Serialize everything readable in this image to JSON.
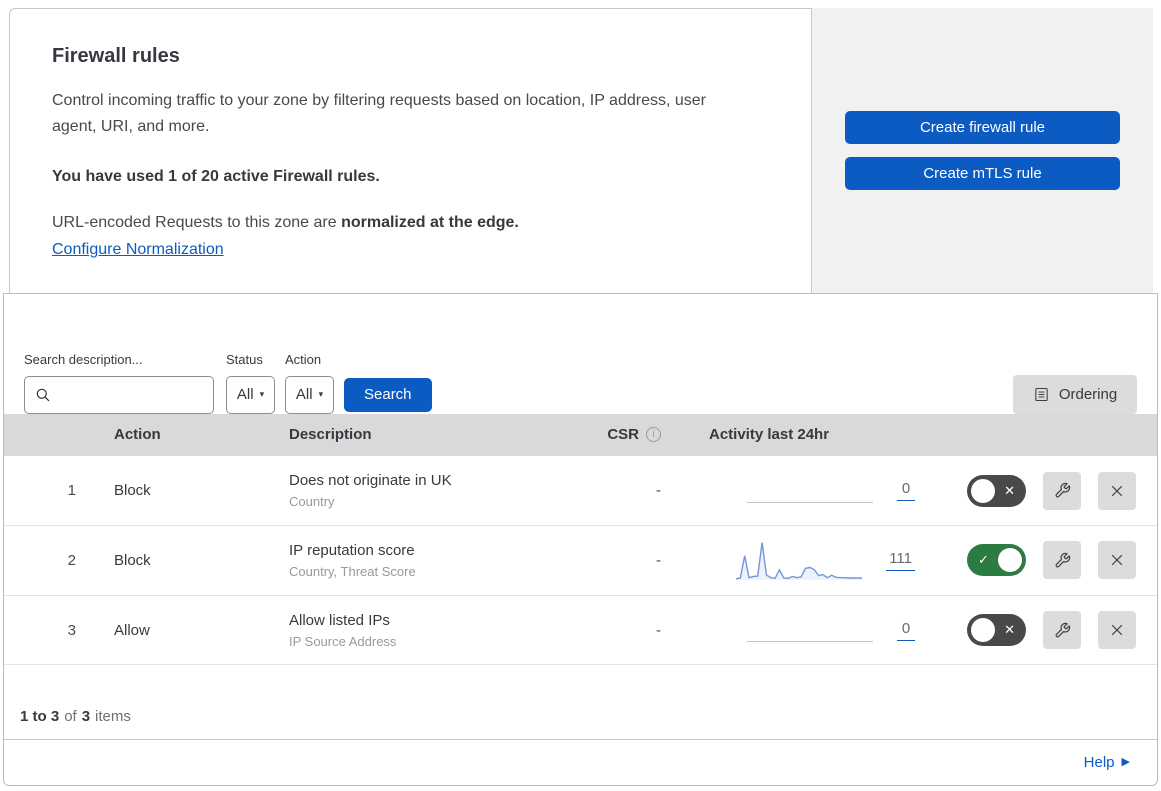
{
  "header": {
    "title": "Firewall rules",
    "description": "Control incoming traffic to your zone by filtering requests based on location, IP address, user agent, URI, and more.",
    "usage": "You have used 1 of 20 active Firewall rules.",
    "normalization_prefix": "URL-encoded Requests to this zone are ",
    "normalization_bold": "normalized at the edge.",
    "normalization_link": "Configure Normalization",
    "create_firewall_label": "Create firewall rule",
    "create_mtls_label": "Create mTLS rule"
  },
  "filters": {
    "search_label": "Search description...",
    "search_value": "",
    "status_label": "Status",
    "status_value": "All",
    "action_label": "Action",
    "action_value": "All",
    "search_button_label": "Search",
    "ordering_button_label": "Ordering"
  },
  "table": {
    "columns": {
      "action": "Action",
      "description": "Description",
      "csr": "CSR",
      "activity": "Activity last 24hr"
    },
    "rows": [
      {
        "index": "1",
        "action": "Block",
        "title": "Does not originate in UK",
        "subtitle": "Country",
        "csr": "-",
        "count": "0",
        "enabled": false,
        "sparkline": null
      },
      {
        "index": "2",
        "action": "Block",
        "title": "IP reputation score",
        "subtitle": "Country, Threat Score",
        "csr": "-",
        "count": "111",
        "enabled": true,
        "sparkline": [
          0.3,
          0.5,
          6.2,
          0.6,
          0.9,
          1.0,
          9.6,
          1.3,
          0.6,
          0.4,
          2.6,
          0.5,
          0.4,
          0.9,
          0.6,
          0.8,
          3.0,
          3.2,
          2.7,
          1.1,
          1.4,
          0.6,
          1.2,
          0.7,
          0.6,
          0.6,
          0.5,
          0.5,
          0.5,
          0.5
        ]
      },
      {
        "index": "3",
        "action": "Allow",
        "title": "Allow listed IPs",
        "subtitle": "IP Source Address",
        "csr": "-",
        "count": "0",
        "enabled": false,
        "sparkline": null
      }
    ]
  },
  "footer": {
    "range": "1 to 3",
    "of_text": "of",
    "total": "3",
    "items_text": "items",
    "help_label": "Help"
  },
  "icons": {
    "search": "magnifier",
    "dropdown_caret": "▾",
    "ordering": "list-document",
    "csr_info_letter": "i",
    "toggle_on_check": "✓",
    "toggle_off_x": "✕",
    "wrench": "wrench",
    "delete": "x-cross",
    "help_arrow": "▶"
  },
  "colors": {
    "accent_blue": "#0b5bc3",
    "link_blue": "#0b5bc3",
    "toggle_on_green": "#2b7b43",
    "toggle_off_gray": "#48494b",
    "sparkline_line": "#7296dd",
    "sparkline_fill": "#eef2fb",
    "table_header_bg": "#d9d9d9",
    "panel_gray": "#f1f1f1",
    "icon_button_bg": "#dcdcdc"
  }
}
